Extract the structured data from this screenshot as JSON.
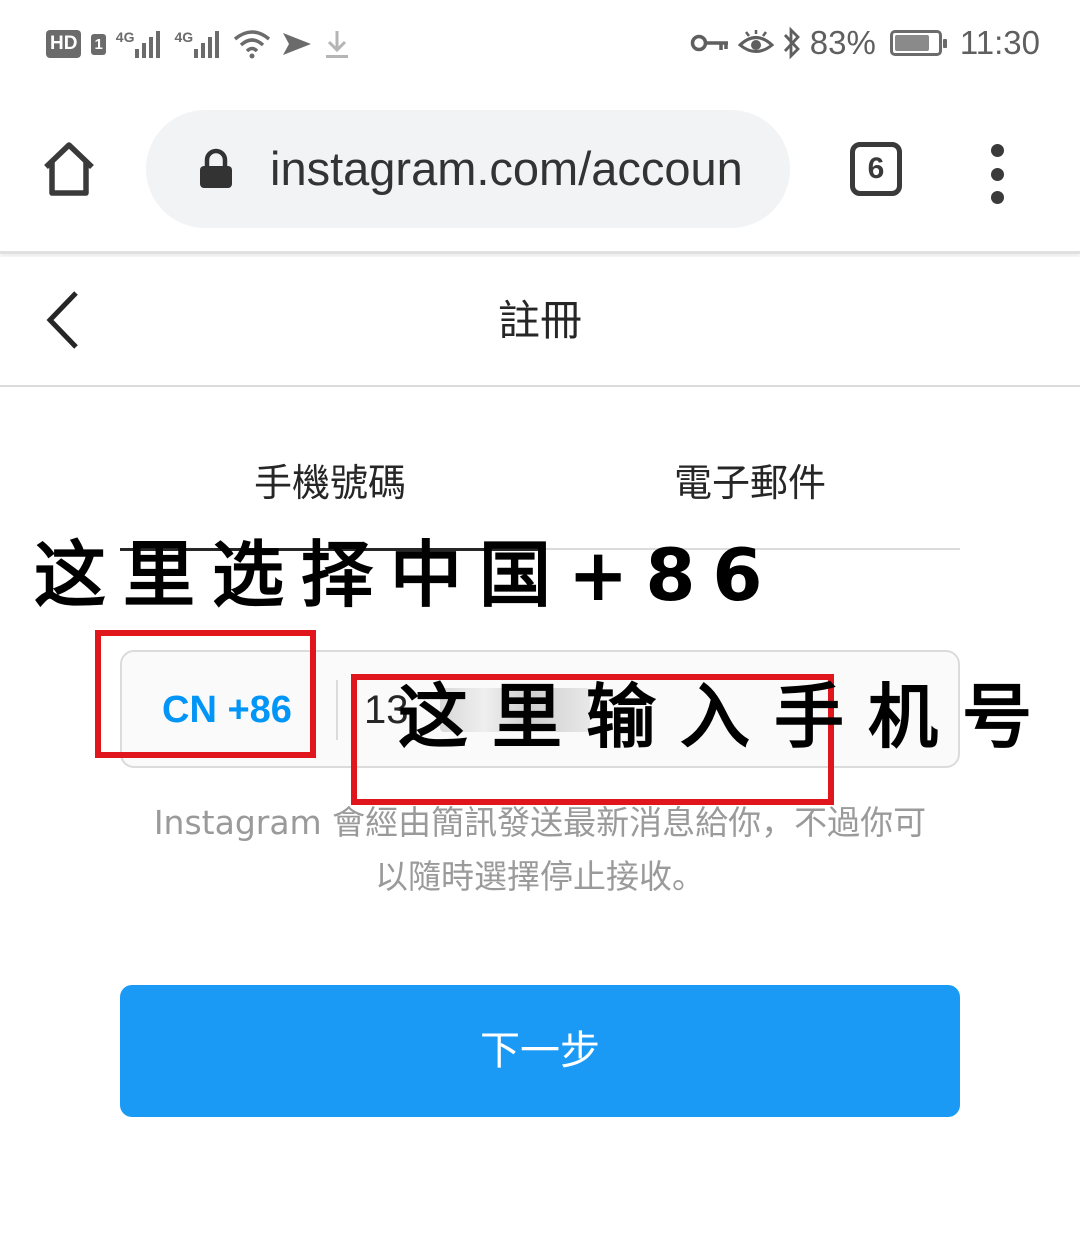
{
  "status_bar": {
    "hd_label": "HD",
    "sim_label": "1",
    "network_label_1": "4G",
    "network_label_2": "4G",
    "battery_level": 0.83,
    "battery_text": "83%",
    "time": "11:30"
  },
  "browser": {
    "url": "instagram.com/accoun",
    "tab_count": "6",
    "icons": [
      "home-icon",
      "lock-icon",
      "tabs-icon",
      "more-vert-icon"
    ]
  },
  "header": {
    "title": "註冊",
    "back_icon": "chevron-left-icon"
  },
  "tabs": [
    {
      "label": "手機號碼",
      "active": true
    },
    {
      "label": "電子郵件",
      "active": false
    }
  ],
  "phone_form": {
    "country_code": "CN +86",
    "phone_value": "13",
    "helper_text_line1": "Instagram 會經由簡訊發送最新消息給你，不過你可",
    "helper_text_line2": "以隨時選擇停止接收。",
    "next_label": "下一步"
  },
  "annotations": {
    "select_country": "这里选择中国+86",
    "enter_phone": "这里输入手机号"
  },
  "colors": {
    "accent": "#0095f6",
    "button": "#1a9af5",
    "annotation_box": "#e0161c"
  }
}
